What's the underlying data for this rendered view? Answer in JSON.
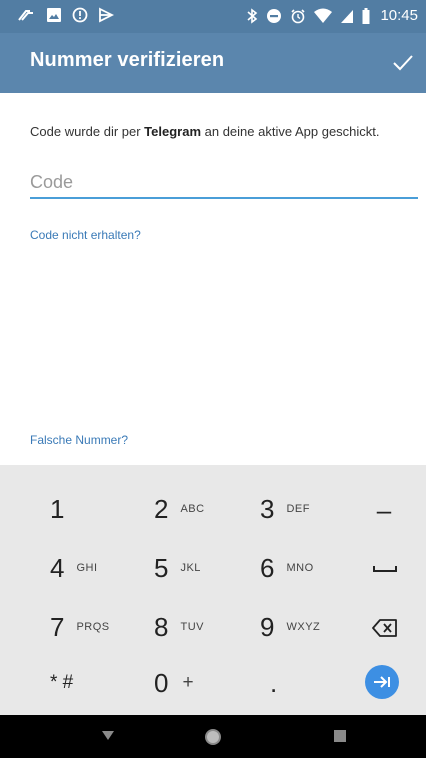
{
  "status_bar": {
    "time": "10:45"
  },
  "app_bar": {
    "title": "Nummer verifizieren"
  },
  "content": {
    "description_before": "Code wurde dir per ",
    "description_bold": "Telegram",
    "description_after": " an deine aktive App geschickt.",
    "code_placeholder": "Code",
    "code_value": "",
    "resend_link": "Code nicht erhalten?",
    "wrong_number_link": "Falsche Nummer?"
  },
  "keypad": {
    "keys": [
      {
        "digit": "1",
        "letters": ""
      },
      {
        "digit": "2",
        "letters": "ABC"
      },
      {
        "digit": "3",
        "letters": "DEF"
      },
      {
        "digit": "4",
        "letters": "GHI"
      },
      {
        "digit": "5",
        "letters": "JKL"
      },
      {
        "digit": "6",
        "letters": "MNO"
      },
      {
        "digit": "7",
        "letters": "PRQS"
      },
      {
        "digit": "8",
        "letters": "TUV"
      },
      {
        "digit": "9",
        "letters": "WXYZ"
      },
      {
        "digit": "* #",
        "letters": ""
      },
      {
        "digit": "0",
        "letters": "+"
      },
      {
        "digit": ".",
        "letters": ""
      }
    ],
    "function_keys": {
      "minus": "–"
    }
  },
  "colors": {
    "status_bar": "#527da3",
    "app_bar": "#5b86ad",
    "accent": "#4a9ed8",
    "link": "#3a7ab7",
    "keypad_bg": "#e8e8e8",
    "enter_button": "#3d8fe3"
  },
  "icons": {
    "status_left": [
      "nfc-icon",
      "image-icon",
      "shield-alert-icon",
      "flag-icon"
    ],
    "status_right": [
      "bluetooth-icon",
      "do-not-disturb-icon",
      "alarm-icon",
      "wifi-icon",
      "signal-icon",
      "battery-icon"
    ],
    "confirm": "check-icon",
    "keypad": [
      "space-icon",
      "backspace-icon",
      "enter-icon"
    ],
    "navigation": [
      "back-icon",
      "home-icon",
      "recents-icon"
    ]
  }
}
